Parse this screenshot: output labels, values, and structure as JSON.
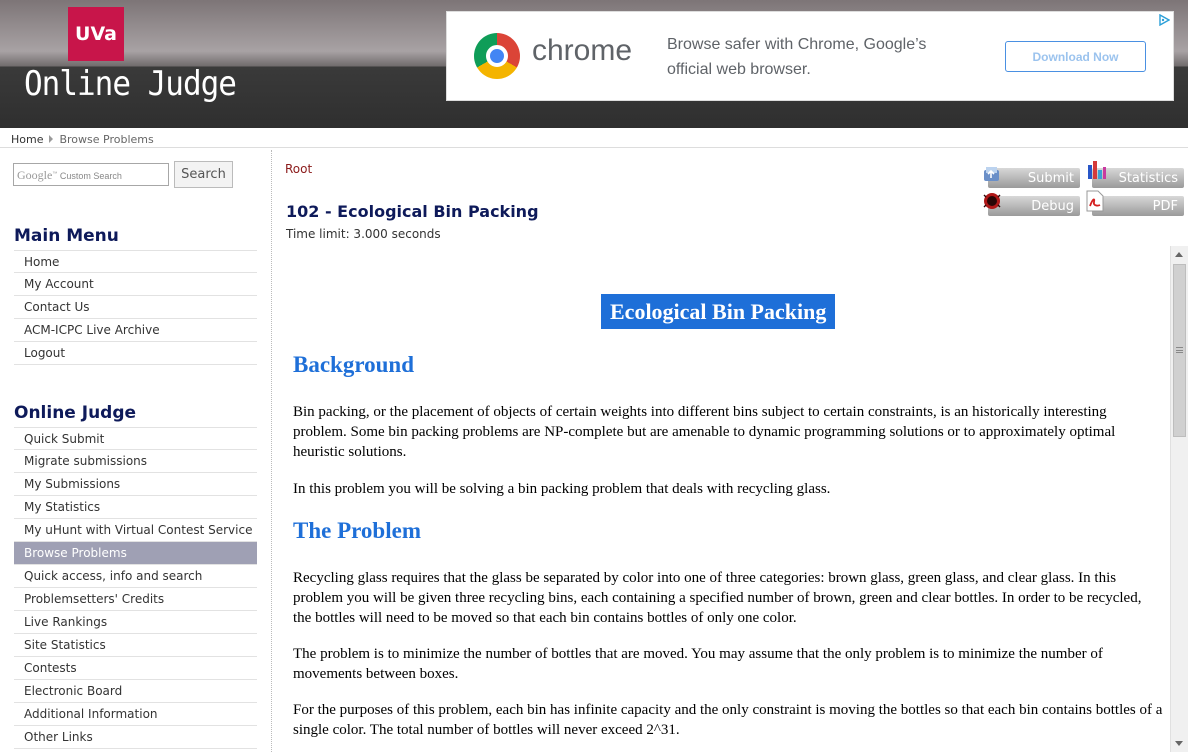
{
  "header": {
    "logo_text": "UVa",
    "site_title": "Online Judge"
  },
  "ad": {
    "brand": "chrome",
    "text": "Browse safer with Chrome, Google’s official web browser.",
    "button_label": "Download Now",
    "adchoices_icon": "adchoices-icon"
  },
  "breadcrumb": {
    "home": "Home",
    "current": "Browse Problems"
  },
  "search": {
    "google_label": "Google",
    "placeholder": "Custom Search",
    "button_label": "Search"
  },
  "main_menu": {
    "title": "Main Menu",
    "items": [
      "Home",
      "My Account",
      "Contact Us",
      "ACM-ICPC Live Archive",
      "Logout"
    ]
  },
  "judge_menu": {
    "title": "Online Judge",
    "items": [
      "Quick Submit",
      "Migrate submissions",
      "My Submissions",
      "My Statistics",
      "My uHunt with Virtual Contest Service",
      "Browse Problems",
      "Quick access, info and search",
      "Problemsetters' Credits",
      "Live Rankings",
      "Site Statistics",
      "Contests",
      "Electronic Board",
      "Additional Information",
      "Other Links"
    ],
    "active": "Browse Problems"
  },
  "problem": {
    "root_link": "Root",
    "title": "102 - Ecological Bin Packing",
    "time_limit": "Time limit: 3.000 seconds"
  },
  "actions": {
    "submit": "Submit",
    "statistics": "Statistics",
    "debug": "Debug",
    "pdf": "PDF"
  },
  "document": {
    "title": "Ecological Bin Packing",
    "background_heading": "Background",
    "background_p1": "Bin packing, or the placement of objects of certain weights into different bins subject to certain constraints, is an historically interesting problem. Some bin packing problems are NP-complete but are amenable to dynamic programming solutions or to approximately optimal heuristic solutions.",
    "background_p2": "In this problem you will be solving a bin packing problem that deals with recycling glass.",
    "problem_heading": "The Problem",
    "problem_p1": "Recycling glass requires that the glass be separated by color into one of three categories: brown glass, green glass, and clear glass. In this problem you will be given three recycling bins, each containing a specified number of brown, green and clear bottles. In order to be recycled, the bottles will need to be moved so that each bin contains bottles of only one color.",
    "problem_p2": "The problem is to minimize the number of bottles that are moved. You may assume that the only problem is to minimize the number of movements between boxes.",
    "problem_p3": "For the purposes of this problem, each bin has infinite capacity and the only constraint is moving the bottles so that each bin contains bottles of a single color. The total number of bottles will never exceed 2^31."
  },
  "colors": {
    "logo_bg": "#c8154a",
    "menu_title": "#0e1a5a",
    "doc_accent": "#1e6fd8",
    "active_item_bg": "#9fa0b4",
    "root_link": "#8b1a1a"
  }
}
